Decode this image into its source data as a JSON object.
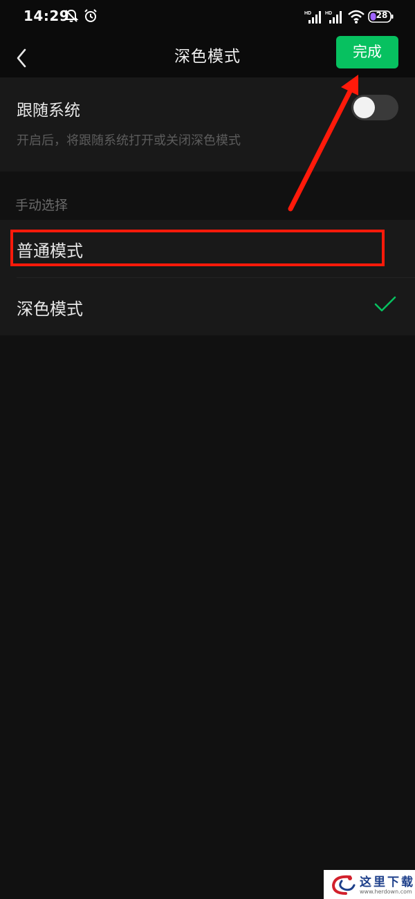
{
  "status_bar": {
    "time": "14:29",
    "battery": "28",
    "network_label": "HD"
  },
  "nav": {
    "title": "深色模式",
    "done_label": "完成"
  },
  "follow_system": {
    "title": "跟随系统",
    "description": "开启后，将跟随系统打开或关闭深色模式",
    "enabled": false
  },
  "manual": {
    "section_label": "手动选择",
    "options": [
      {
        "label": "普通模式",
        "selected": false
      },
      {
        "label": "深色模式",
        "selected": true
      }
    ]
  },
  "colors": {
    "accent": "#07c160",
    "annotation": "#ff1a0a",
    "background": "#111111",
    "card": "#191919"
  },
  "watermark": {
    "text_cn": "这里下载",
    "url": "www.herdown.com"
  }
}
